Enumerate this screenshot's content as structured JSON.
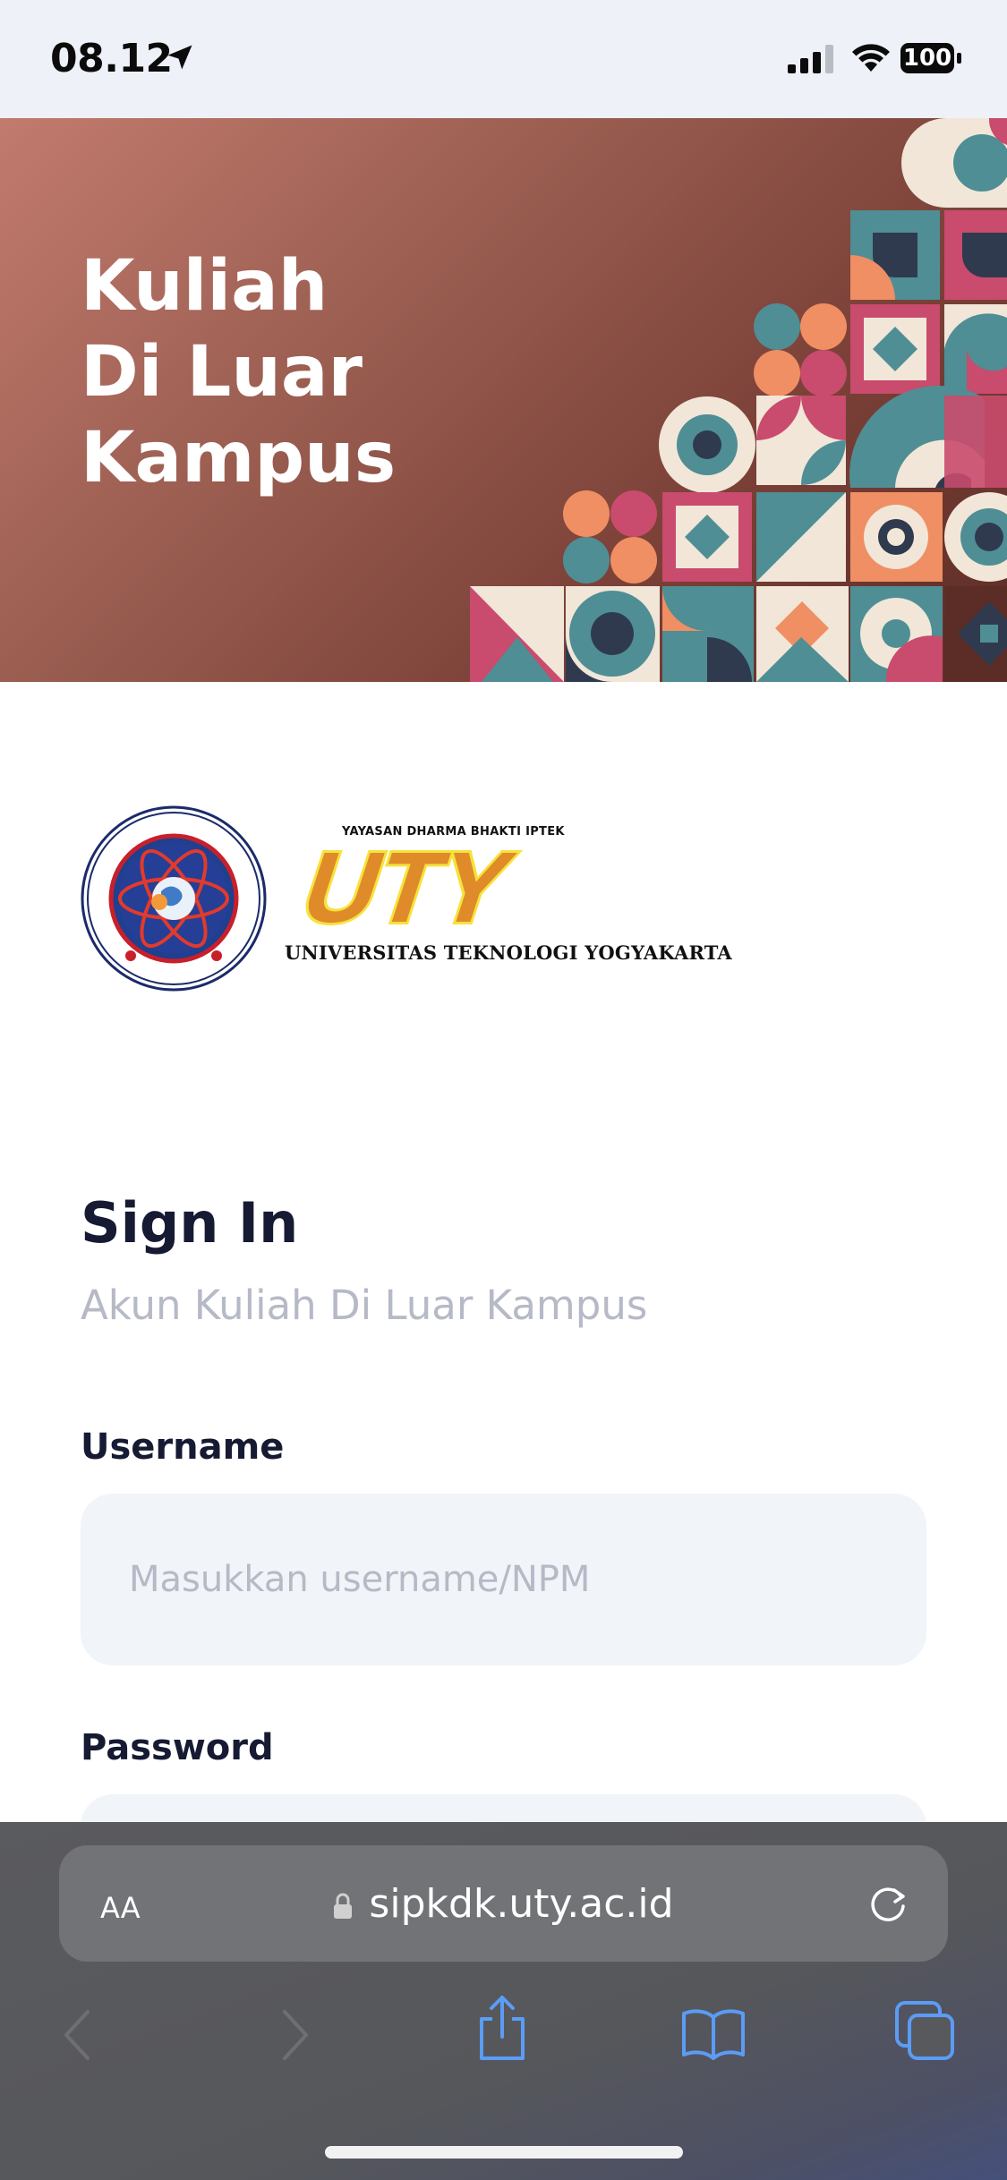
{
  "status_bar": {
    "time": "08.12",
    "battery": "100"
  },
  "hero": {
    "title_lines": [
      "Kuliah",
      "Di Luar",
      "Kampus"
    ],
    "background_color": "#8a4c42"
  },
  "logo": {
    "seal_icon": "uty-seal-icon",
    "foundation": "YAYASAN DHARMA BHAKTI IPTEK",
    "wordmark": "UTY",
    "university": "UNIVERSITAS TEKNOLOGI YOGYAKARTA"
  },
  "signin": {
    "title": "Sign In",
    "subtitle": "Akun Kuliah Di Luar Kampus",
    "username_label": "Username",
    "username_placeholder": "Masukkan username/NPM",
    "password_label": "Password"
  },
  "browser": {
    "text_size_label": "AA",
    "url": "sipkdk.uty.ac.id",
    "accent_color": "#5b9cf5"
  }
}
